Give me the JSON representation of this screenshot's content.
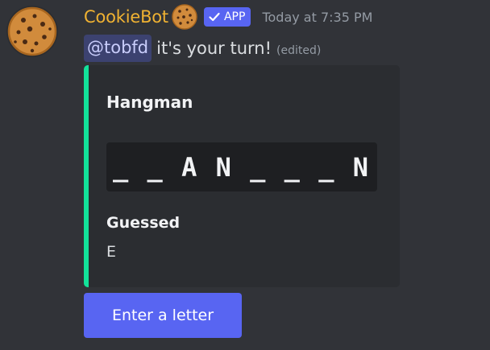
{
  "message": {
    "author": {
      "name": "CookieBot",
      "avatar_icon": "cookie-icon",
      "name_color": "#f0b232",
      "badge_label": "APP",
      "badge_icon": "checkmark-icon"
    },
    "timestamp": "Today at 7:35 PM",
    "mention": "@tobfd",
    "text": "it's your turn!",
    "edited_label": "(edited)"
  },
  "embed": {
    "accent_color": "#13e29a",
    "title": "Hangman",
    "word_display": "_ _ A N _ _ _ N",
    "fields": [
      {
        "name": "Guessed",
        "value": "E"
      }
    ]
  },
  "actions": {
    "button_label": "Enter a letter",
    "button_color": "#5865f2"
  }
}
